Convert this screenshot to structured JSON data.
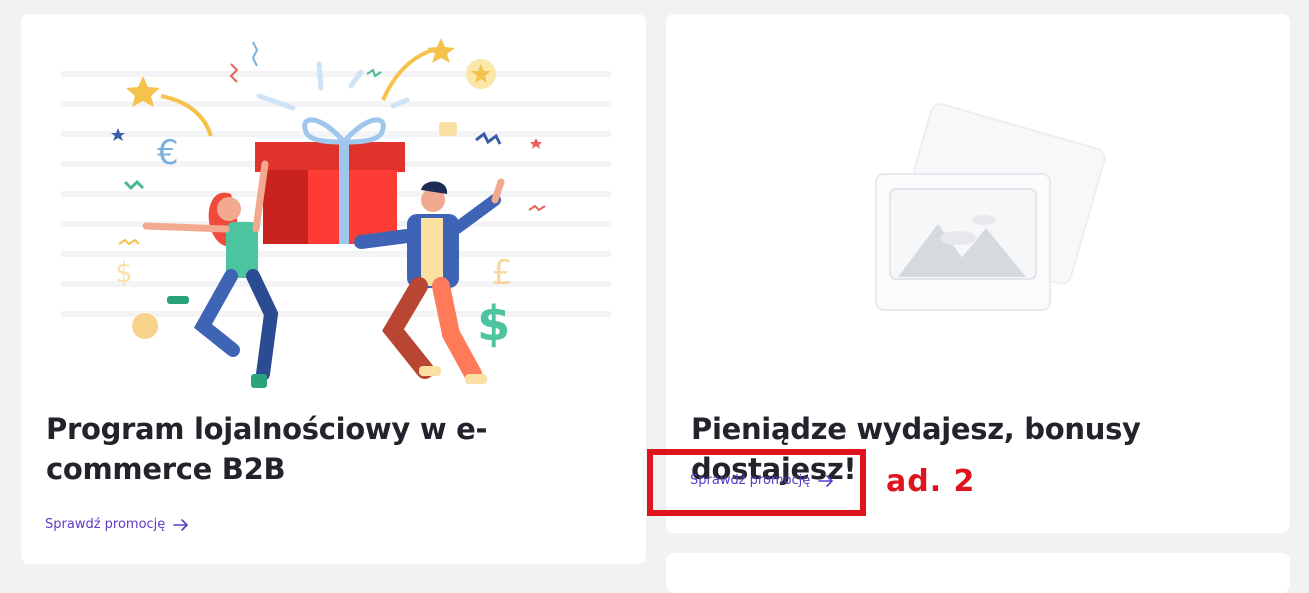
{
  "cards": [
    {
      "title": "Program lojalnościowy w e-commerce B2B",
      "link_label": "Sprawdź promocję",
      "image": "gift-celebration-illustration"
    },
    {
      "title": "Pieniądze wydajesz, bonusy dostajesz!",
      "link_label": "Sprawdź promocję",
      "image": "image-placeholder-icon"
    }
  ],
  "annotation": {
    "label": "ad. 2",
    "color": "#e0141c"
  },
  "colors": {
    "background": "#f1f2f4",
    "card": "#ffffff",
    "title": "#23232b",
    "link": "#5b3bc7",
    "annotation": "#e0141c"
  }
}
